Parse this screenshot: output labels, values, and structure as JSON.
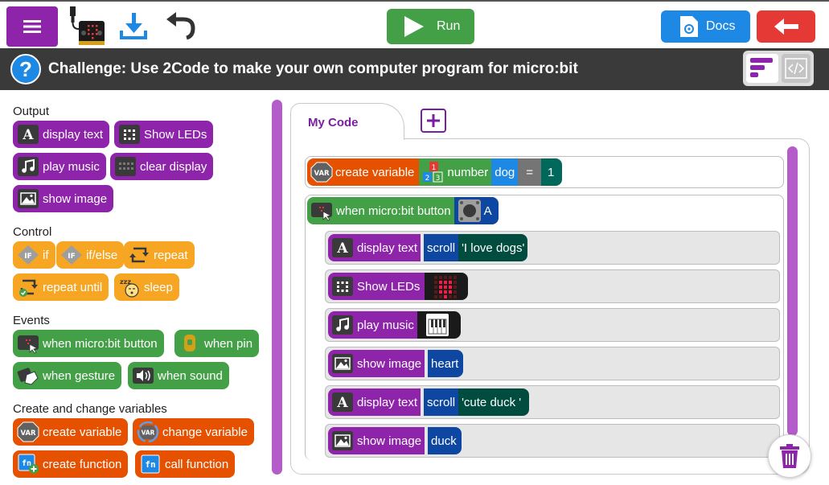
{
  "topbar": {
    "run_label": "Run",
    "docs_label": "Docs"
  },
  "challenge": {
    "text": "Challenge: Use 2Code to make your own computer program for micro:bit",
    "help_symbol": "?"
  },
  "palette": {
    "categories": [
      {
        "title": "Output",
        "blocks": [
          "display text",
          "Show LEDs",
          "play music",
          "clear display",
          "show image"
        ]
      },
      {
        "title": "Control",
        "blocks": [
          "if",
          "if/else",
          "repeat",
          "repeat until",
          "sleep"
        ]
      },
      {
        "title": "Events",
        "blocks": [
          "when micro:bit button",
          "when pin",
          "when gesture",
          "when sound"
        ]
      },
      {
        "title": "Create and change variables",
        "blocks": [
          "create variable",
          "change variable",
          "create function",
          "call function"
        ]
      }
    ]
  },
  "workspace": {
    "tab_label": "My Code",
    "variable_block": {
      "label": "create variable",
      "type_label": "number",
      "name": "dog",
      "operator": "=",
      "value": "1",
      "type_icon_digits": [
        "1",
        "2",
        "3"
      ]
    },
    "event_block": {
      "label": "when micro:bit button",
      "button": "A"
    },
    "statements": [
      {
        "label": "display text",
        "mode": "scroll",
        "text": "'I love dogs'"
      },
      {
        "label": "Show LEDs"
      },
      {
        "label": "play music"
      },
      {
        "label": "show image",
        "image": "heart"
      },
      {
        "label": "display text",
        "mode": "scroll",
        "text": "'cute duck '"
      },
      {
        "label": "show image",
        "image": "duck"
      }
    ]
  },
  "icons": {
    "var_icon_text": "VAR",
    "fn_icon_text": "fn",
    "if_icon_text": "IF",
    "text_icon_letter": "A",
    "sleep_icon_text": "zzz"
  },
  "colors": {
    "output_purple": "#8e24aa",
    "control_gold": "#f6a623",
    "events_green": "#43a047",
    "variables_orange": "#e65100",
    "value_blue": "#0d47a1",
    "value_teal": "#00695c",
    "run_green": "#43a047",
    "docs_blue": "#1e88e5",
    "back_red": "#e53935"
  }
}
